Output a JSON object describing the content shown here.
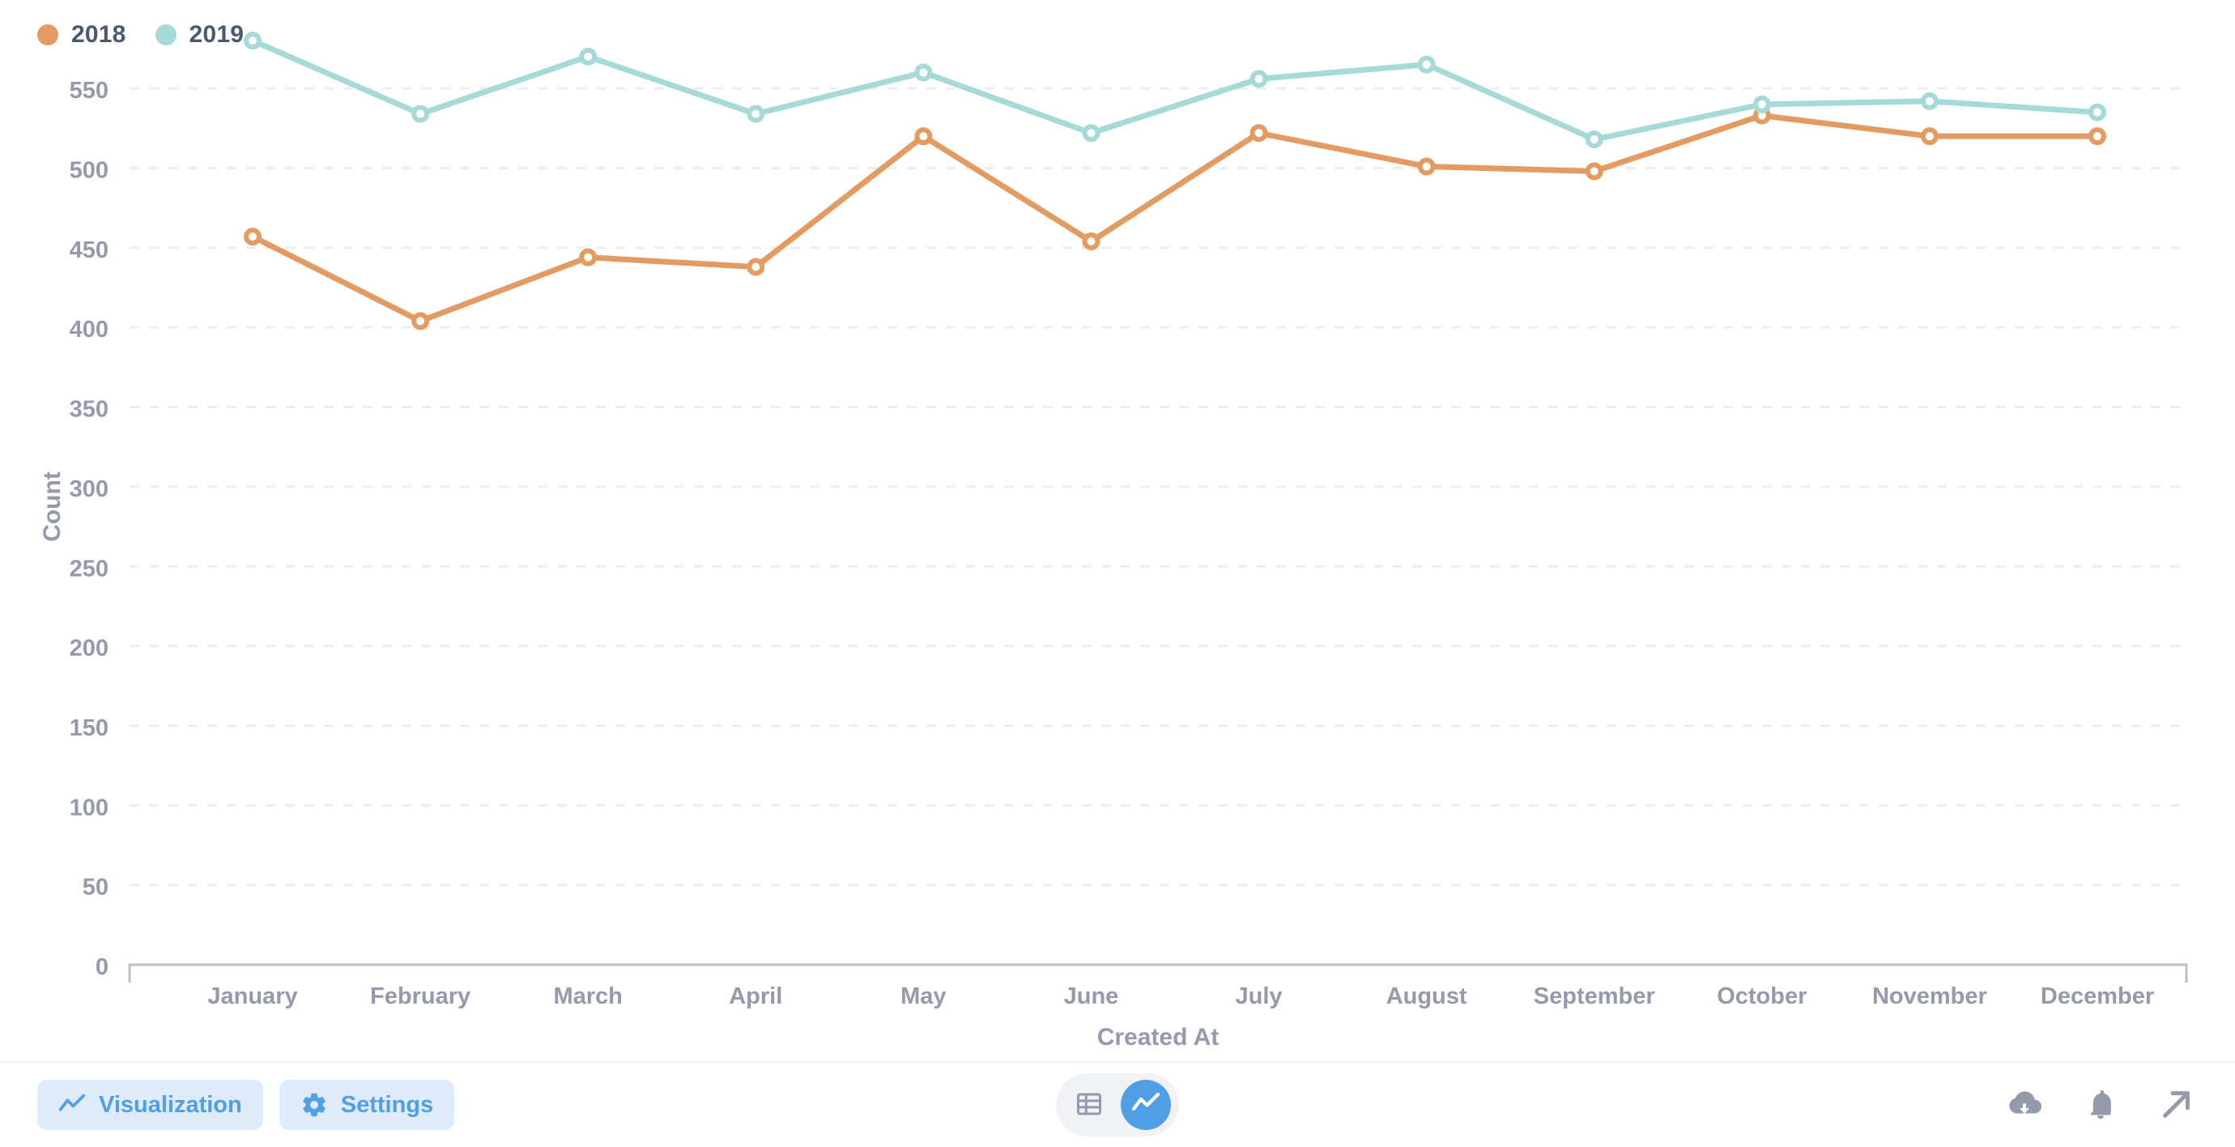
{
  "legend": {
    "items": [
      {
        "label": "2018",
        "color": "#EF8C8C_PLACEHOLDER"
      },
      {
        "label": "2019",
        "color": "#A6DAD8"
      }
    ]
  },
  "colors": {
    "series_2018": "#E49B62",
    "series_2019": "#A6DAD8",
    "axis_text": "#949AAB",
    "axis_title": "#949AAB",
    "legend_text": "#4C5773",
    "gridline": "#EDEDED",
    "axis_line": "#B8BFCA",
    "accent_blue": "#509EE3",
    "accent_blue_bg": "#DEEBFB",
    "toolbar_border": "#EDF0F3",
    "icon_gray": "#949AAB",
    "toggle_bg": "#F0F2F5"
  },
  "toolbar": {
    "visualization_label": "Visualization",
    "settings_label": "Settings",
    "table_view_title": "Table view",
    "chart_view_title": "Chart view",
    "download_title": "Download results",
    "alert_title": "Alerts",
    "expand_title": "Open in new window"
  },
  "chart_data": {
    "type": "line",
    "title": "",
    "xlabel": "Created At",
    "ylabel": "Count",
    "categories": [
      "January",
      "February",
      "March",
      "April",
      "May",
      "June",
      "July",
      "August",
      "September",
      "October",
      "November",
      "December"
    ],
    "series": [
      {
        "name": "2018",
        "color": "#E49B62",
        "values": [
          457,
          404,
          444,
          438,
          520,
          454,
          522,
          501,
          498,
          533,
          520,
          520
        ]
      },
      {
        "name": "2019",
        "color": "#A6DAD8",
        "values": [
          580,
          534,
          570,
          534,
          560,
          522,
          556,
          565,
          518,
          540,
          542,
          535
        ]
      }
    ],
    "ylim": [
      0,
      575
    ],
    "yticks": [
      0,
      50,
      100,
      150,
      200,
      250,
      300,
      350,
      400,
      450,
      500,
      550
    ],
    "ytick_labels": [
      "0",
      "50",
      "100",
      "150",
      "200",
      "250",
      "300",
      "350",
      "400",
      "450",
      "500",
      "550"
    ],
    "grid": true,
    "grid_style": "dashed-horizontal",
    "legend_position": "top-left",
    "marker": "hollow-circle"
  }
}
